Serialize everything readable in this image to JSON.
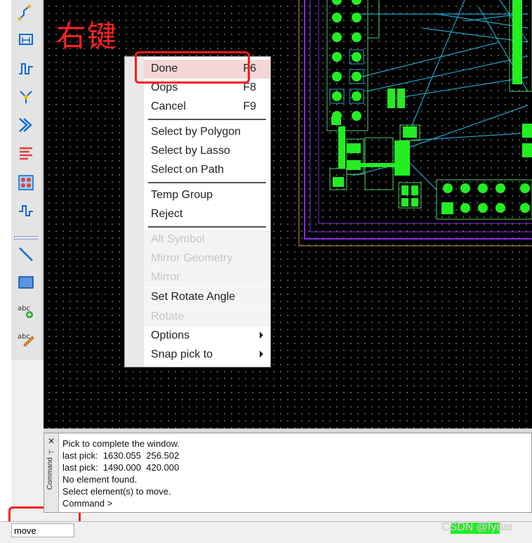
{
  "annotation": {
    "right_click_label": "右键",
    "color": "#ff2222"
  },
  "toolbar": {
    "icons": [
      "route-icon",
      "dimension-icon",
      "delay-tune-icon",
      "fanout-icon",
      "bus-route-icon",
      "spread-lines-icon",
      "grid-array-icon",
      "tune-icon",
      "line-icon",
      "rectangle-icon",
      "add-text-icon",
      "edit-text-icon"
    ]
  },
  "context_menu": {
    "items": [
      {
        "label": "Done",
        "key": "F6",
        "state": "highlighted"
      },
      {
        "label": "Oops",
        "key": "F8"
      },
      {
        "label": "Cancel",
        "key": "F9"
      },
      {
        "label": "Select by Polygon"
      },
      {
        "label": "Select by Lasso"
      },
      {
        "label": "Select on Path"
      },
      {
        "label": "Temp Group"
      },
      {
        "label": "Reject"
      },
      {
        "label": "Alt Symbol",
        "state": "disabled"
      },
      {
        "label": "Mirror Geometry",
        "state": "disabled"
      },
      {
        "label": "Mirror",
        "state": "disabled"
      },
      {
        "label": "Set Rotate Angle"
      },
      {
        "label": "Rotate",
        "state": "disabled"
      },
      {
        "label": "Options",
        "submenu": true
      },
      {
        "label": "Snap pick to",
        "submenu": true
      }
    ]
  },
  "command_panel": {
    "title": "Command",
    "lines": [
      "Pick to complete the window.",
      "last pick:  1630.055  256.502",
      "last pick:  1490.000  420.000",
      "No element found.",
      "Select element(s) to move.",
      "Command >"
    ]
  },
  "status_bar": {
    "command": "move"
  },
  "watermark": "CSDN @fydar",
  "colors": {
    "pcb_background": "#000000",
    "pad_green": "#22ee22",
    "ratsnest_cyan": "#1fa3c4",
    "outline_purple": "#8a2be2",
    "highlight_box": "#ff1a1a"
  }
}
